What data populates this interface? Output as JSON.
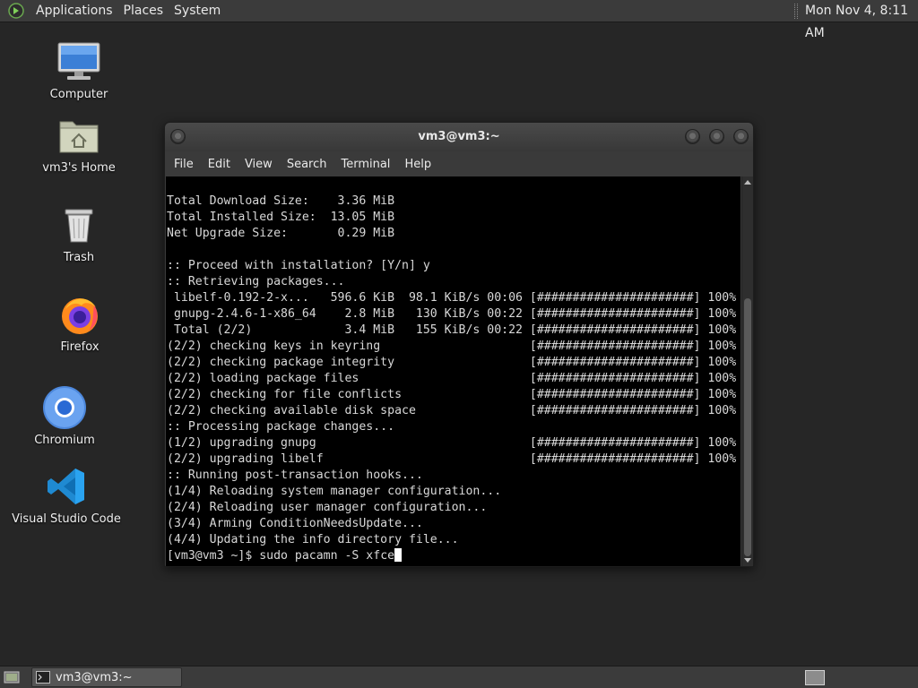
{
  "top_panel": {
    "menus": [
      "Applications",
      "Places",
      "System"
    ],
    "clock": "Mon Nov 4, 8:11 AM"
  },
  "desktop": {
    "icons": [
      {
        "label": "Computer",
        "icon": "computer-icon"
      },
      {
        "label": "vm3's Home",
        "icon": "home-folder-icon"
      },
      {
        "label": "Trash",
        "icon": "trash-icon"
      },
      {
        "label": "Firefox",
        "icon": "firefox-icon"
      },
      {
        "label": "Chromium",
        "icon": "chromium-icon"
      },
      {
        "label": "Visual Studio Code",
        "icon": "vscode-icon"
      }
    ]
  },
  "terminal": {
    "title": "vm3@vm3:~",
    "menus": [
      "File",
      "Edit",
      "View",
      "Search",
      "Terminal",
      "Help"
    ],
    "lines": [
      "Total Download Size:    3.36 MiB",
      "Total Installed Size:  13.05 MiB",
      "Net Upgrade Size:       0.29 MiB",
      "",
      ":: Proceed with installation? [Y/n] y",
      ":: Retrieving packages...",
      " libelf-0.192-2-x...   596.6 KiB  98.1 KiB/s 00:06 [######################] 100%",
      " gnupg-2.4.6-1-x86_64    2.8 MiB   130 KiB/s 00:22 [######################] 100%",
      " Total (2/2)             3.4 MiB   155 KiB/s 00:22 [######################] 100%",
      "(2/2) checking keys in keyring                     [######################] 100%",
      "(2/2) checking package integrity                   [######################] 100%",
      "(2/2) loading package files                        [######################] 100%",
      "(2/2) checking for file conflicts                  [######################] 100%",
      "(2/2) checking available disk space                [######################] 100%",
      ":: Processing package changes...",
      "(1/2) upgrading gnupg                              [######################] 100%",
      "(2/2) upgrading libelf                             [######################] 100%",
      ":: Running post-transaction hooks...",
      "(1/4) Reloading system manager configuration...",
      "(2/4) Reloading user manager configuration...",
      "(3/4) Arming ConditionNeedsUpdate...",
      "(4/4) Updating the info directory file..."
    ],
    "prompt": "[vm3@vm3 ~]$ ",
    "command": "sudo pacamn -S xfce"
  },
  "bottom_panel": {
    "task_label": "vm3@vm3:~"
  },
  "colors": {
    "desktop_bg": "#262626",
    "panel_bg": "#3b3b3b",
    "terminal_bg": "#000000",
    "terminal_fg": "#d8d8d8"
  }
}
